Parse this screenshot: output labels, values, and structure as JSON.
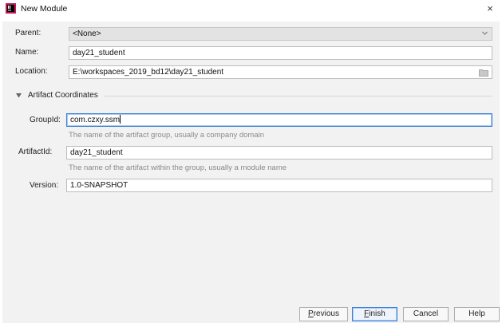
{
  "window": {
    "title": "New Module",
    "close_glyph": "×",
    "app_icon": "intellij-idea-icon"
  },
  "form": {
    "parent": {
      "label": "Parent:",
      "value": "<None>"
    },
    "name": {
      "label": "Name:",
      "value": "day21_student"
    },
    "location": {
      "label": "Location:",
      "value": "E:\\workspaces_2019_bd12\\day21_student"
    }
  },
  "artifact": {
    "section_title": "Artifact Coordinates",
    "group_id": {
      "label": "GroupId:",
      "value": "com.czxy.ssm",
      "hint": "The name of the artifact group, usually a company domain"
    },
    "artifact_id": {
      "label": "ArtifactId:",
      "value": "day21_student",
      "hint": "The name of the artifact within the group, usually a module name"
    },
    "version": {
      "label": "Version:",
      "value": "1.0-SNAPSHOT"
    }
  },
  "buttons": {
    "previous": {
      "mnemonic": "P",
      "rest": "revious"
    },
    "finish": {
      "mnemonic": "F",
      "rest": "inish"
    },
    "cancel": "Cancel",
    "help": "Help"
  },
  "colors": {
    "focus_border": "#3c7fd6",
    "panel_bg": "#f2f2f2",
    "hint_text": "#8a8a8a"
  }
}
